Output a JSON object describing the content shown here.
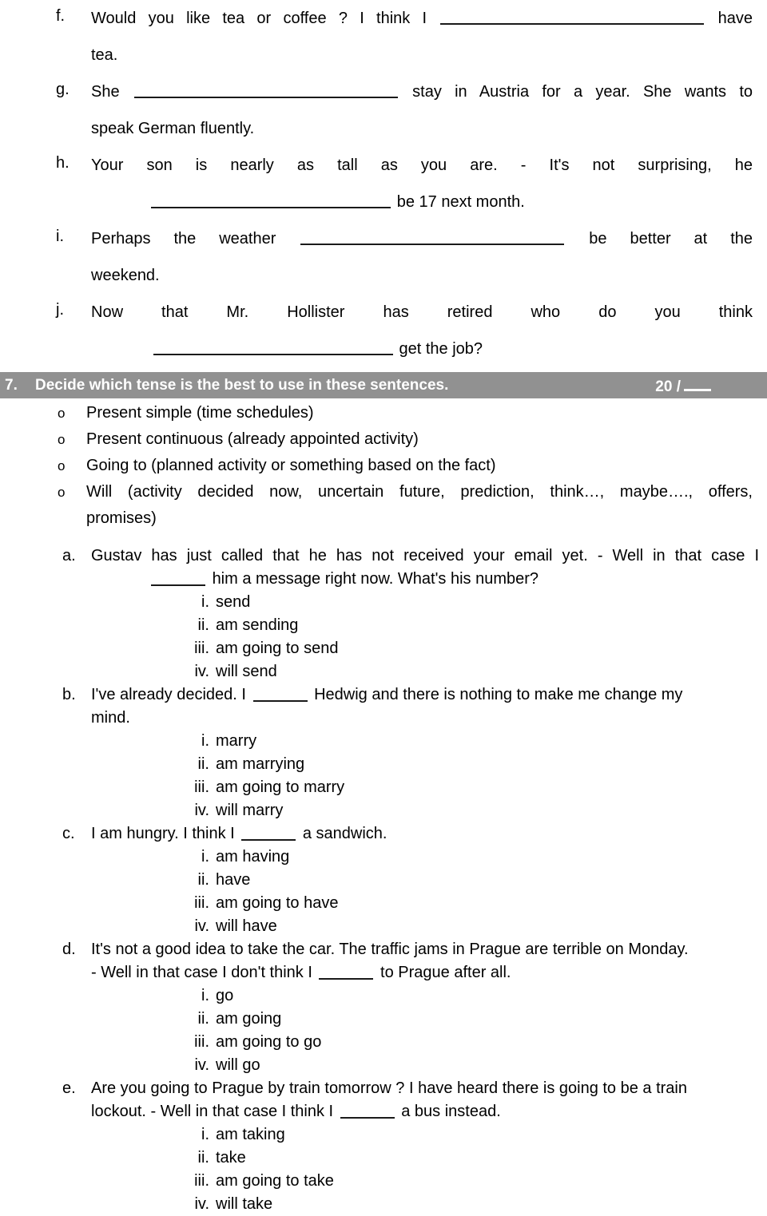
{
  "document": {
    "type": "english-grammar-worksheet"
  },
  "upper_exercise": {
    "items": [
      {
        "marker": "f.",
        "line1_pre": "Would you like tea or coffee ? I think I",
        "line1_post": "have",
        "line2": "tea."
      },
      {
        "marker": "g.",
        "line1_pre": "She",
        "line1_post": "stay in Austria for a year. She wants to",
        "line2": "speak German fluently."
      },
      {
        "marker": "h.",
        "line1_pre": "Your son is nearly as tall as you are. - It's not surprising, he",
        "line1_post": "",
        "line2_post": "be 17 next month."
      },
      {
        "marker": "i.",
        "line1_pre": "Perhaps the weather",
        "line1_post": "be better at the",
        "line2": "weekend."
      },
      {
        "marker": "j.",
        "line1_pre": "Now that Mr. Hollister has retired who do you think",
        "line1_post": "",
        "line2_post": "get the job?"
      }
    ]
  },
  "section": {
    "number": "7.",
    "title": "Decide which tense is the best to use in these sentences.",
    "score_value": "20 /",
    "bar_color": "#919191",
    "bar_text_color": "#ffffff"
  },
  "tense_options": {
    "bullet_glyph": "o",
    "items": [
      "Present simple (time schedules)",
      "Present continuous (already appointed activity)",
      "Going to (planned activity or something based on the fact)",
      "Will (activity decided now, uncertain future, prediction, think…, maybe…., offers,",
      "promises)"
    ]
  },
  "questions": [
    {
      "marker": "a.",
      "stem_part1": "Gustav has just called that he has not received your email yet. - Well in that case I",
      "stem_part2": "him a message right now. What's his number?",
      "options": [
        {
          "num": "i.",
          "text": "send"
        },
        {
          "num": "ii.",
          "text": "am sending"
        },
        {
          "num": "iii.",
          "text": "am going to send"
        },
        {
          "num": "iv.",
          "text": "will send"
        }
      ]
    },
    {
      "marker": "b.",
      "stem_part1": "I've already decided. I",
      "stem_part2": "Hedwig and there is nothing to make me change my",
      "stem_part3": "mind.",
      "options": [
        {
          "num": "i.",
          "text": "marry"
        },
        {
          "num": "ii.",
          "text": "am marrying"
        },
        {
          "num": "iii.",
          "text": "am going to marry"
        },
        {
          "num": "iv.",
          "text": "will marry"
        }
      ]
    },
    {
      "marker": "c.",
      "stem_part1": "I am hungry. I think I",
      "stem_part2": "a sandwich.",
      "options": [
        {
          "num": "i.",
          "text": "am having"
        },
        {
          "num": "ii.",
          "text": "have"
        },
        {
          "num": "iii.",
          "text": "am going to have"
        },
        {
          "num": "iv.",
          "text": "will have"
        }
      ]
    },
    {
      "marker": "d.",
      "stem_part1": "It's not a good idea to take the car. The traffic jams in Prague are terrible on Monday.",
      "stem_part2": "- Well in that case I don't think I",
      "stem_part3": "to Prague after all.",
      "options": [
        {
          "num": "i.",
          "text": "go"
        },
        {
          "num": "ii.",
          "text": "am going"
        },
        {
          "num": "iii.",
          "text": "am going to go"
        },
        {
          "num": "iv.",
          "text": "will go"
        }
      ]
    },
    {
      "marker": "e.",
      "stem_part1": "Are you going to Prague by train tomorrow ? I have heard there is going to be a train",
      "stem_part2": "lockout. - Well in that case I think I",
      "stem_part3": "a bus instead.",
      "options": [
        {
          "num": "i.",
          "text": "am taking"
        },
        {
          "num": "ii.",
          "text": "take"
        },
        {
          "num": "iii.",
          "text": "am going to take"
        },
        {
          "num": "iv.",
          "text": "will take"
        }
      ]
    }
  ]
}
